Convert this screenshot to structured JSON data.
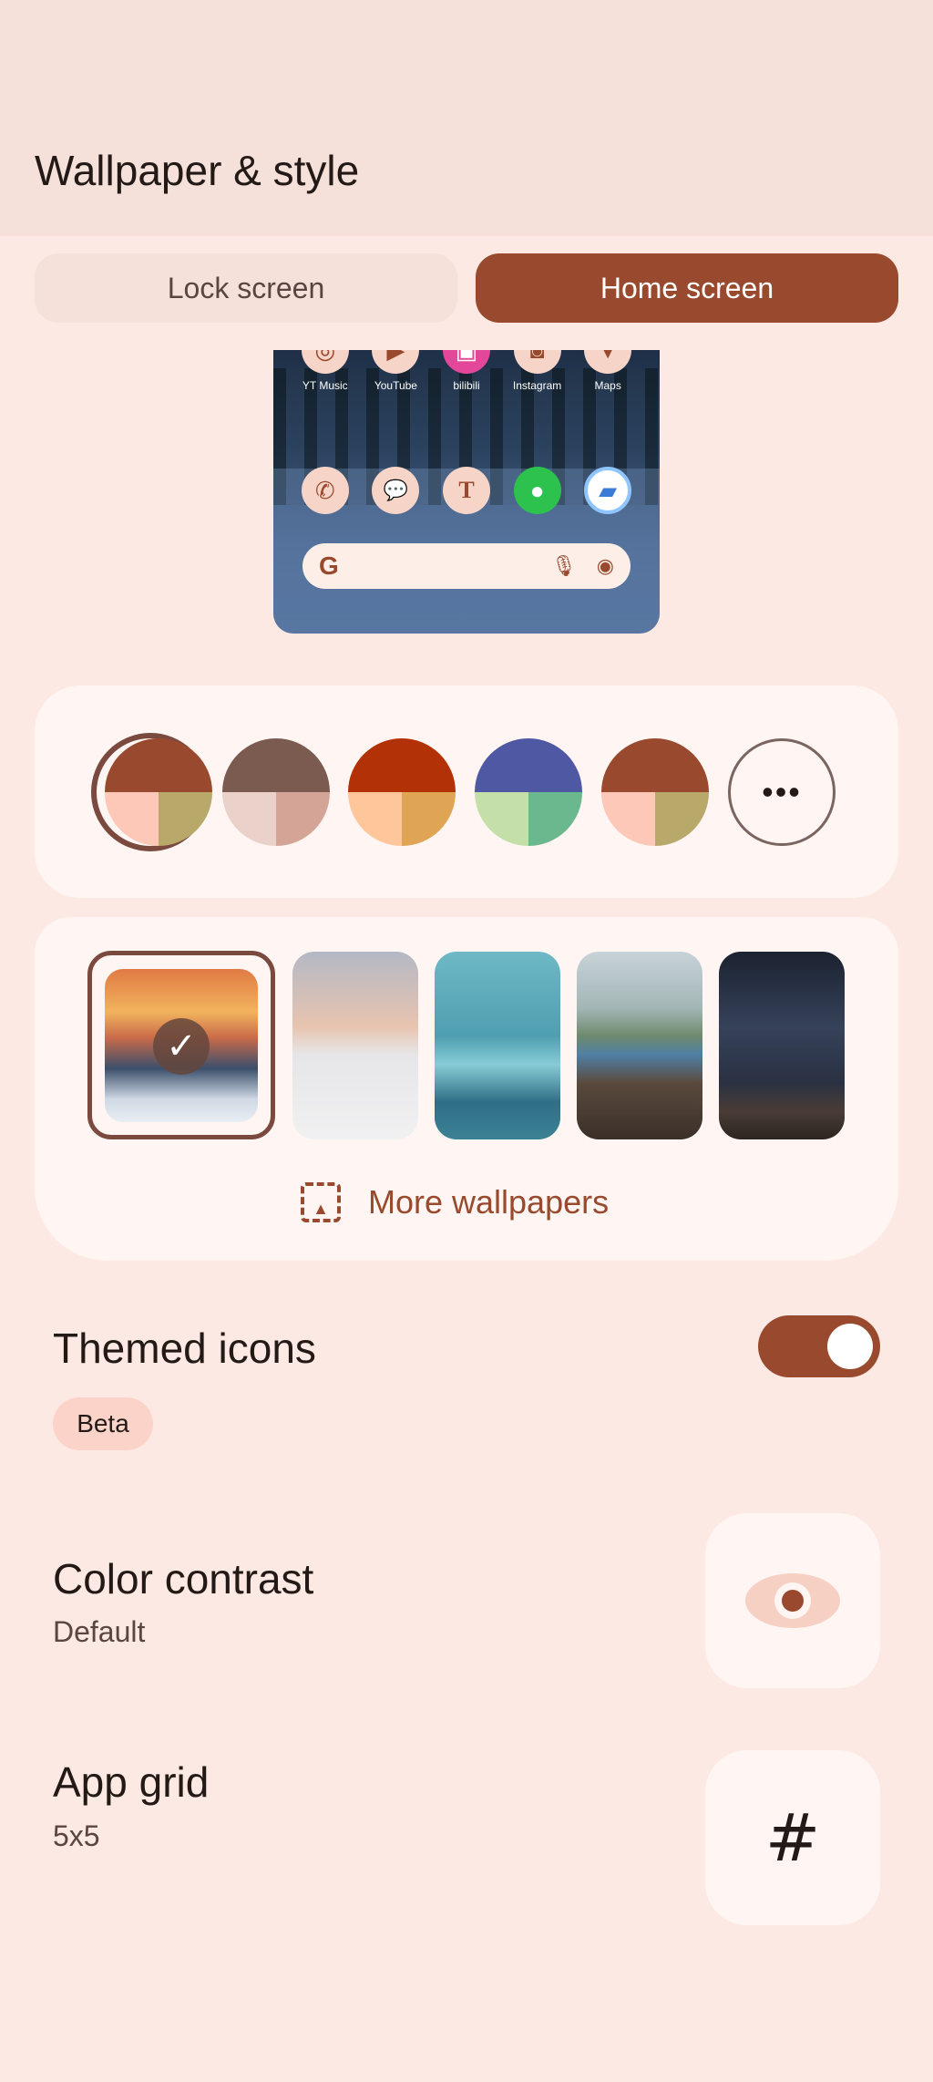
{
  "header": {
    "title": "Wallpaper & style"
  },
  "tabs": [
    {
      "label": "Lock screen",
      "selected": false
    },
    {
      "label": "Home screen",
      "selected": true
    }
  ],
  "preview": {
    "apps_top": [
      {
        "label": "YT Music",
        "icon": "yt-music-icon"
      },
      {
        "label": "YouTube",
        "icon": "youtube-icon"
      },
      {
        "label": "bilibili",
        "icon": "bilibili-icon"
      },
      {
        "label": "Instagram",
        "icon": "instagram-icon"
      },
      {
        "label": "Maps",
        "icon": "maps-icon"
      }
    ],
    "dock": [
      {
        "icon": "phone-icon",
        "glyph": "✆"
      },
      {
        "icon": "messages-icon",
        "glyph": "💬"
      },
      {
        "icon": "tesla-icon",
        "glyph": "T"
      },
      {
        "icon": "wechat-icon",
        "glyph": "●"
      },
      {
        "icon": "files-icon",
        "glyph": "▰"
      }
    ],
    "search_g": "G"
  },
  "color_options": [
    {
      "top": "#994a2e",
      "bl": "#fdc8b8",
      "br": "#b8a96a",
      "selected": true
    },
    {
      "top": "#7b5a50",
      "bl": "#ead1c9",
      "br": "#d4a497",
      "selected": false
    },
    {
      "top": "#b23106",
      "bl": "#fdc79b",
      "br": "#dfa454",
      "selected": false
    },
    {
      "top": "#4f59a3",
      "bl": "#c4dfa8",
      "br": "#6bb88e",
      "selected": false
    },
    {
      "top": "#994a2e",
      "bl": "#fdc8b8",
      "br": "#b8a96a",
      "selected": false
    }
  ],
  "more_colors_glyph": "•••",
  "wallpapers": [
    {
      "name": "mountain-sunset",
      "selected": true
    },
    {
      "name": "white-sands",
      "selected": false
    },
    {
      "name": "glacier",
      "selected": false
    },
    {
      "name": "coast",
      "selected": false
    },
    {
      "name": "milky-way",
      "selected": false
    }
  ],
  "check_glyph": "✓",
  "more_wallpapers": {
    "label": "More wallpapers"
  },
  "themed_icons": {
    "title": "Themed icons",
    "badge": "Beta",
    "enabled": true
  },
  "color_contrast": {
    "title": "Color contrast",
    "value": "Default"
  },
  "app_grid": {
    "title": "App grid",
    "value": "5x5",
    "glyph": "#"
  }
}
